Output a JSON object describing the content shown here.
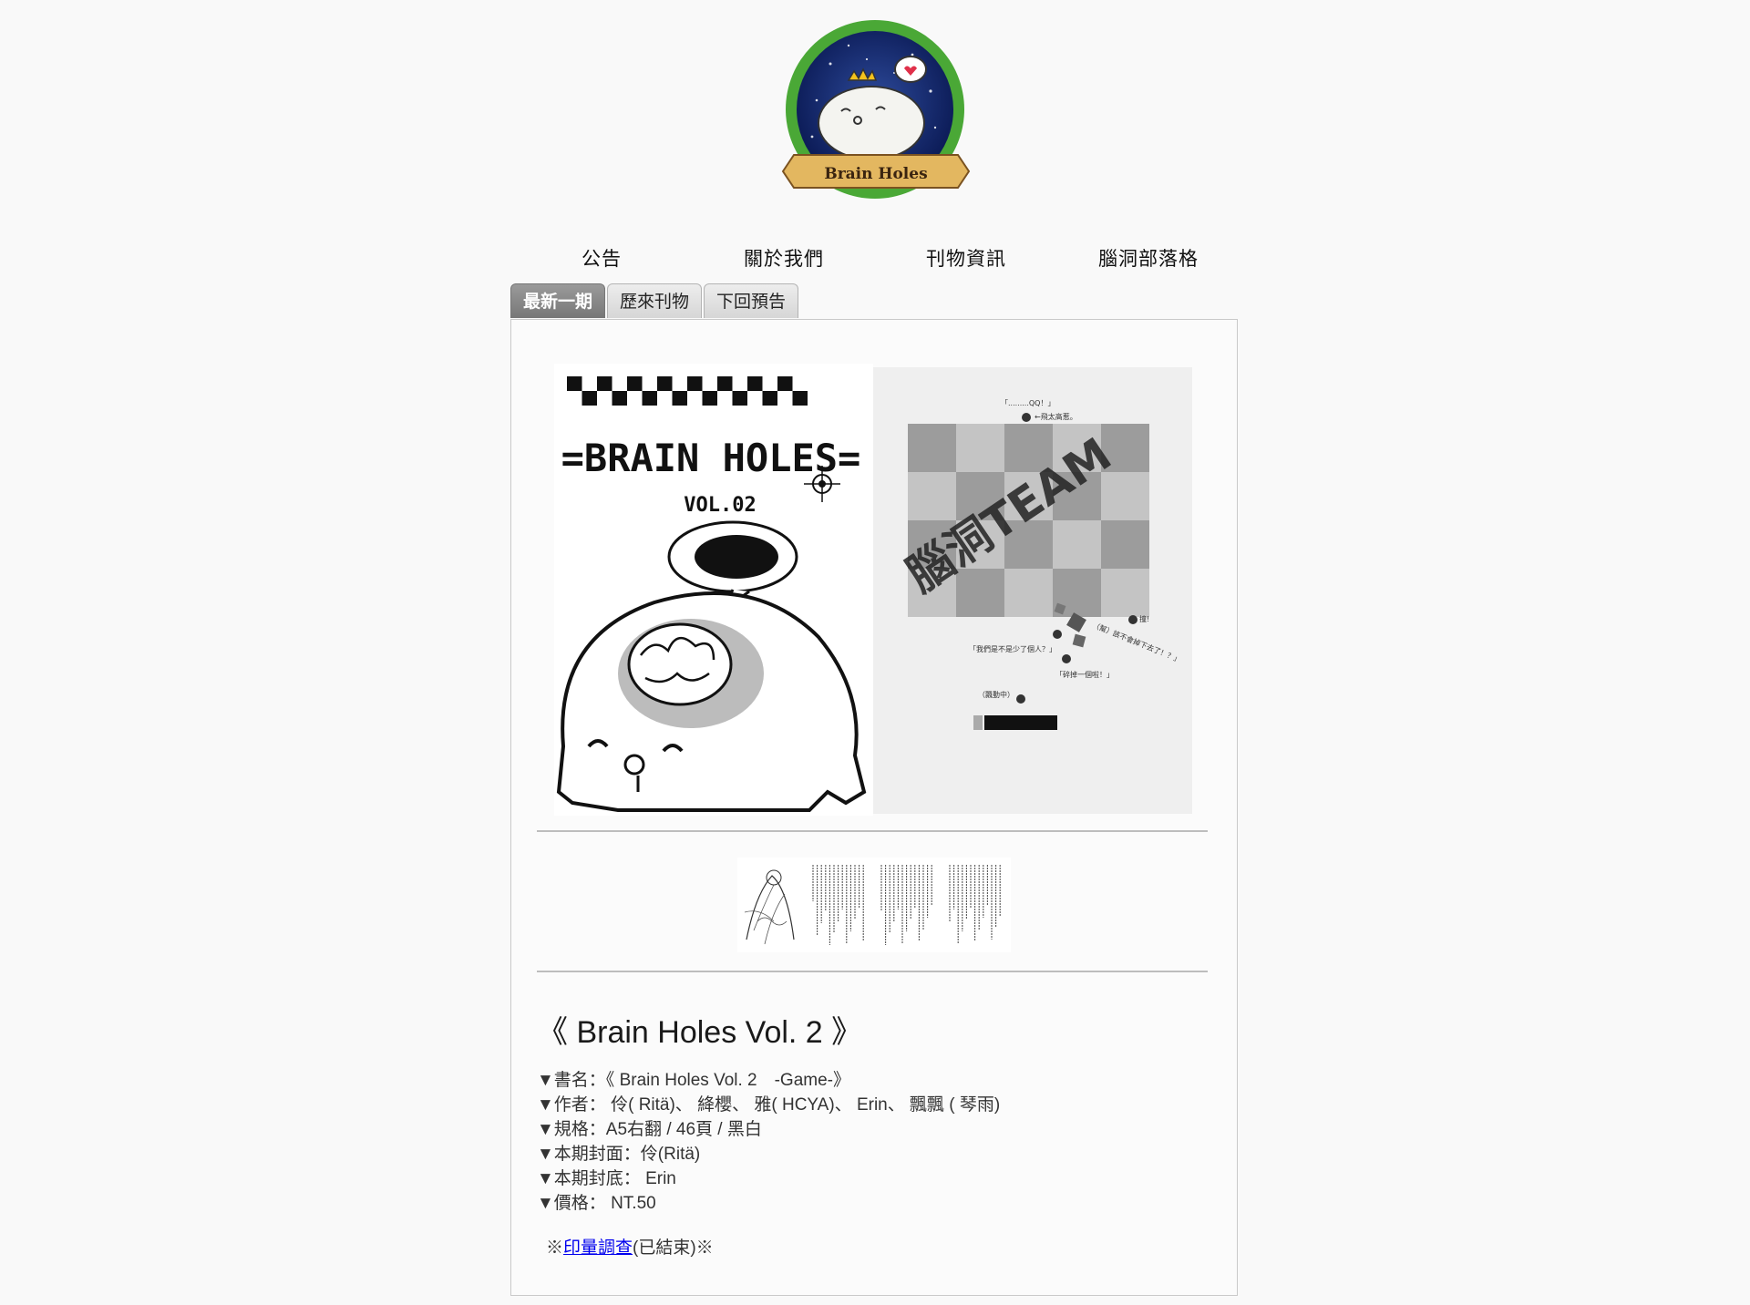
{
  "logo": {
    "text": "Brain Holes"
  },
  "nav": {
    "items": [
      {
        "label": "公告"
      },
      {
        "label": "關於我們"
      },
      {
        "label": "刊物資訊"
      },
      {
        "label": "腦洞部落格"
      }
    ]
  },
  "tabs": [
    {
      "label": "最新一期",
      "active": true
    },
    {
      "label": "歷來刊物",
      "active": false
    },
    {
      "label": "下回預告",
      "active": false
    }
  ],
  "front_cover": {
    "title": "=BRAIN HOLES=",
    "volume": "VOL.02"
  },
  "back_cover": {
    "stamp": "腦洞TEAM",
    "captions": [
      "「.........QQ！」",
      "←飛太高惹。",
      "撞!",
      "（幫）該不會掉下去了！？」",
      "「我們是不是少了個人？」",
      "「碎掉一個啦！」",
      "（飄動中）"
    ]
  },
  "issue": {
    "title": "《 Brain Holes Vol. 2 》",
    "specs": [
      "▼書名：《 Brain Holes Vol. 2　-Game-》",
      "▼作者： 伶( Ritä)、 絳櫻、 雅( HCYA)、 Erin、 飄飄 ( 琴雨)",
      "▼規格：A5右翻 / 46頁 / 黑白",
      "▼本期封面：伶(Ritä)",
      "▼本期封底： Erin",
      "▼價格： NT.50"
    ],
    "survey_prefix": "※",
    "survey_link": "印量調查",
    "survey_suffix": "(已結束)※"
  }
}
